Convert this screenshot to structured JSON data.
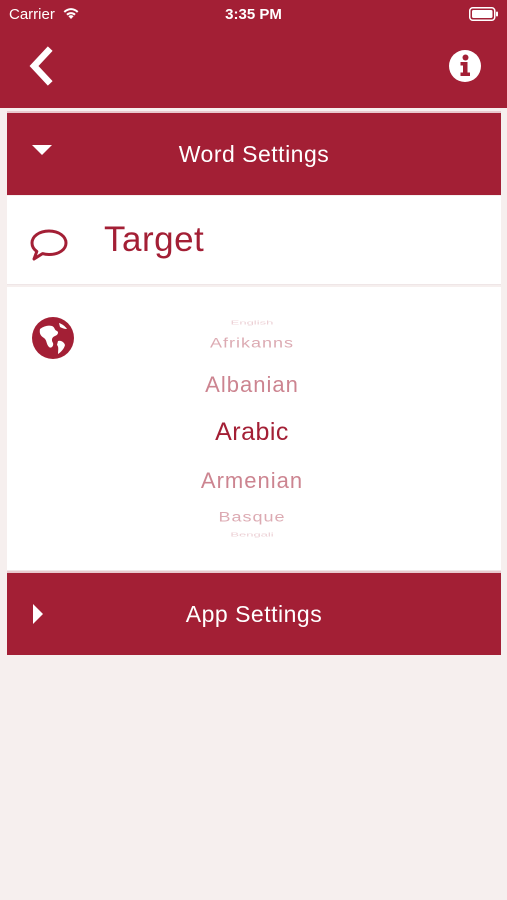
{
  "status_bar": {
    "carrier": "Carrier",
    "time": "3:35 PM"
  },
  "colors": {
    "primary": "#a31f35",
    "background": "#f6efee",
    "panel": "#ffffff"
  },
  "nav": {
    "back_icon": "chevron-left-icon",
    "info_icon": "info-circle-icon"
  },
  "word_settings": {
    "title": "Word Settings",
    "expanded": true,
    "target_label": "Target",
    "language_picker": {
      "options": [
        "English",
        "Afrikanns",
        "Albanian",
        "Arabic",
        "Armenian",
        "Basque",
        "Bengali"
      ],
      "selected": "Arabic"
    }
  },
  "app_settings": {
    "title": "App Settings",
    "expanded": false
  }
}
